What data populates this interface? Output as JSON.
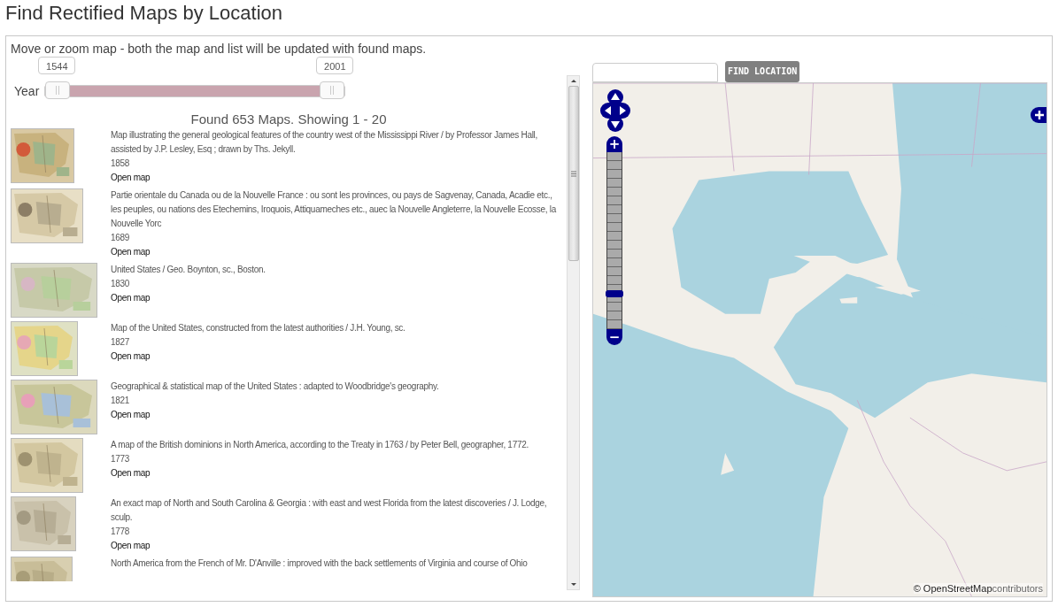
{
  "page_title": "Find Rectified Maps by Location",
  "intro": "Move or zoom map - both the map and list will be updated with found maps.",
  "year_filter": {
    "label": "Year",
    "min_value": "1544",
    "max_value": "2001"
  },
  "results_heading": "Found 653 Maps. Showing 1 - 20",
  "results": [
    {
      "title": "Map illustrating the general geological features of the country west of the Mississippi River / by Professor James Hall, assisted by J.P. Lesley, Esq ; drawn by Ths. Jekyll.",
      "year": "1858",
      "link": "Open map"
    },
    {
      "title": "Partie orientale du Canada ou de la Nouvelle France : ou sont les provinces, ou pays de Sagvenay, Canada, Acadie etc., les peuples, ou nations des Etechemins, Iroquois, Attiquameches etc., auec la Nouvelle Angleterre, la Nouvelle Ecosse, la Nouvelle Yorc",
      "year": "1689",
      "link": "Open map"
    },
    {
      "title": "United States / Geo. Boynton, sc., Boston.",
      "year": "1830",
      "link": "Open map"
    },
    {
      "title": "Map of the United States, constructed from the latest authorities / J.H. Young, sc.",
      "year": "1827",
      "link": "Open map"
    },
    {
      "title": "Geographical & statistical map of the United States : adapted to Woodbridge's geography.",
      "year": "1821",
      "link": "Open map"
    },
    {
      "title": "A map of the British dominions in North America, according to the Treaty in 1763 / by Peter Bell, geographer, 1772.",
      "year": "1773",
      "link": "Open map"
    },
    {
      "title": "An exact map of North and South Carolina & Georgia : with east and west Florida from the latest discoveries / J. Lodge, sculp.",
      "year": "1778",
      "link": "Open map"
    },
    {
      "title": "North America from the French of Mr. D'Anville : improved with the back settlements of Virginia and course of Ohio"
    }
  ],
  "location_search": {
    "button": "FIND LOCATION"
  },
  "map": {
    "zoom": {
      "plus": "+",
      "minus": "−",
      "level": 0.2
    },
    "attribution": {
      "link": "© OpenStreetMap",
      "text": "contributors"
    }
  }
}
